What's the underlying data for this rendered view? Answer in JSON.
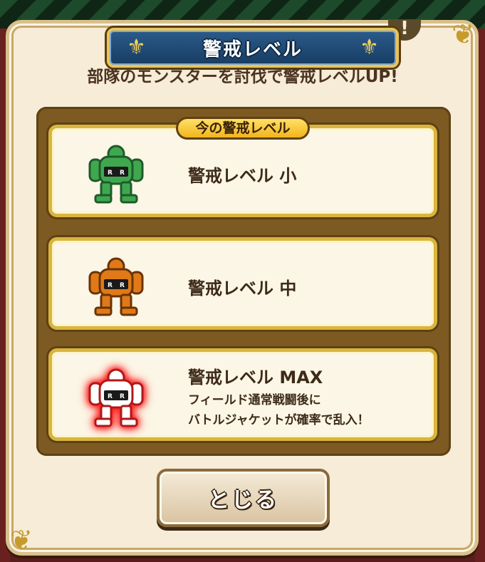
{
  "dialog": {
    "title": "警戒レベル",
    "subtitle": "部隊のモンスターを討伐で警戒レベルUP!",
    "current_tag": "今の警戒レベル",
    "info_icon_label": "!",
    "close_label": "とじる"
  },
  "levels": [
    {
      "name": "警戒レベル 小",
      "color": "#3fa84f",
      "dark": "#1f5a2a",
      "desc1": "",
      "desc2": ""
    },
    {
      "name": "警戒レベル 中",
      "color": "#e07a18",
      "dark": "#6a3306",
      "desc1": "",
      "desc2": ""
    },
    {
      "name": "警戒レベル MAX",
      "color": "#ffffff",
      "dark": "#b01818",
      "desc1": "フィールド通常戦闘後に",
      "desc2": "バトルジャケットが確率で乱入！"
    }
  ],
  "colors": {
    "dialog_bg": "#f6ecd7",
    "banner": "#1f4a73",
    "gold": "#d9b43e",
    "panel": "#7d5a22"
  }
}
